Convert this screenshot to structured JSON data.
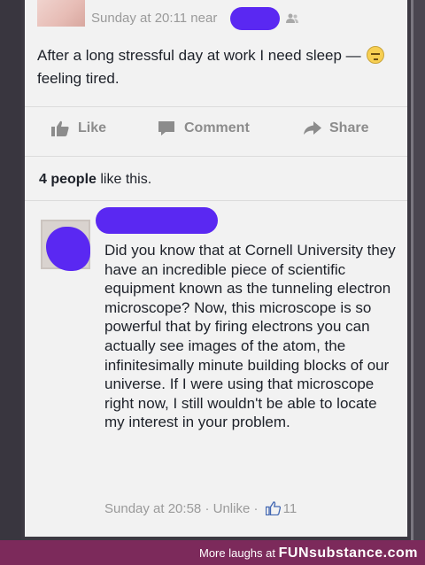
{
  "post": {
    "timestamp": "Sunday at 20:11 near",
    "text_main": "After a long stressful day at work I need sleep —",
    "feeling": "feeling tired.",
    "feeling_icon": "tired-face-emoji",
    "audience_icon": "friends-icon"
  },
  "actions": {
    "like": "Like",
    "comment": "Comment",
    "share": "Share"
  },
  "likes": {
    "count_text": "4 people",
    "suffix": "like this."
  },
  "comment": {
    "text": "Did you know that at Cornell University they have an incredible piece of scientific equipment known as the tunneling electron microscope? Now, this microscope is so powerful that by firing electrons you can actually see images of the atom, the infinitesimally minute building blocks of our universe. If I were using that microscope right now, I still wouldn't be able to locate my interest in your problem.",
    "time": "Sunday at 20:58",
    "sep": "·",
    "unlike": "Unlike",
    "like_count": "11"
  },
  "footer": {
    "prefix": "More laughs at",
    "brand": "FUNsubstance.com"
  },
  "colors": {
    "redaction": "#5a28f2",
    "footer_bg": "#7c2a5b",
    "like_blue": "#4267b2"
  }
}
